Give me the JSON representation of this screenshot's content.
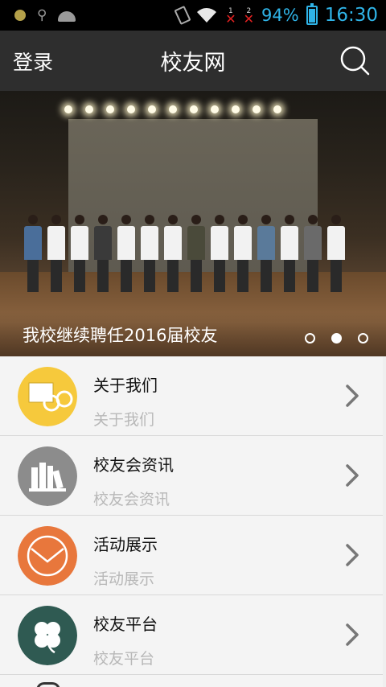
{
  "status_bar": {
    "icons": [
      "notification-dot-icon",
      "usb-icon",
      "android-icon",
      "vibrate-icon",
      "wifi-icon",
      "sim1-no-signal-icon",
      "sim2-no-signal-icon",
      "battery-icon"
    ],
    "sim1_label": "1",
    "sim2_label": "2",
    "battery_percent": "94%",
    "battery_level": 0.94,
    "time": "16:30",
    "accent_color": "#2fb4e8"
  },
  "header": {
    "login_label": "登录",
    "title": "校友网",
    "search_icon": "search-icon",
    "background_color": "#2e2e2e"
  },
  "banner": {
    "caption": "我校继续聘任2016届校友",
    "slide_count": 3,
    "active_slide": 2
  },
  "menu": {
    "items": [
      {
        "title": "关于我们",
        "subtitle": "关于我们",
        "icon": "about-us-icon",
        "icon_color": "#f6c93c"
      },
      {
        "title": "校友会资讯",
        "subtitle": "校友会资讯",
        "icon": "books-icon",
        "icon_color": "#8c8c8c"
      },
      {
        "title": "活动展示",
        "subtitle": "活动展示",
        "icon": "envelope-icon",
        "icon_color": "#e8773c"
      },
      {
        "title": "校友平台",
        "subtitle": "校友平台",
        "icon": "clover-icon",
        "icon_color": "#2f5a52"
      }
    ],
    "chevron_icon": "chevron-right-icon"
  }
}
